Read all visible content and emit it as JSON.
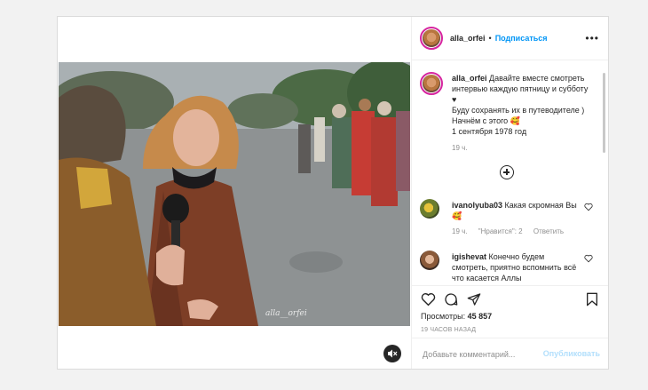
{
  "post": {
    "username": "alla_orfei",
    "separator": "•",
    "follow_label": "Подписаться",
    "more_icon": "more-horizontal-icon",
    "watermark": "alla__orfei",
    "sound_icon": "muted-speaker-icon"
  },
  "caption": {
    "username": "alla_orfei",
    "line1": "Давайте вместе смотреть интервью каждую пятницу и субботу ♥",
    "line2": "Буду сохранять их в путеводителе )",
    "line3": "Начнём с этого 🥰",
    "line4": "1 сентября 1978 год",
    "time": "19 ч."
  },
  "comments": [
    {
      "username": "ivanolyuba03",
      "text": "Какая скромная Вы🥰",
      "time": "19 ч.",
      "likes": "\"Нравится\": 2",
      "reply": "Ответить"
    },
    {
      "username": "igishevat",
      "text": "Конечно будем смотреть, приятно вспомнить всё что касается Аллы"
    }
  ],
  "actions": {
    "views_label": "Просмотры:",
    "views_count": "45 857",
    "time_ago": "19 ЧАСОВ НАЗАД"
  },
  "add_comment": {
    "placeholder": "Добавьте комментарий...",
    "publish_label": "Опубликовать"
  },
  "colors": {
    "accent": "#0095f6",
    "publish_disabled": "#b2dffc",
    "muted": "#8e8e8e"
  }
}
